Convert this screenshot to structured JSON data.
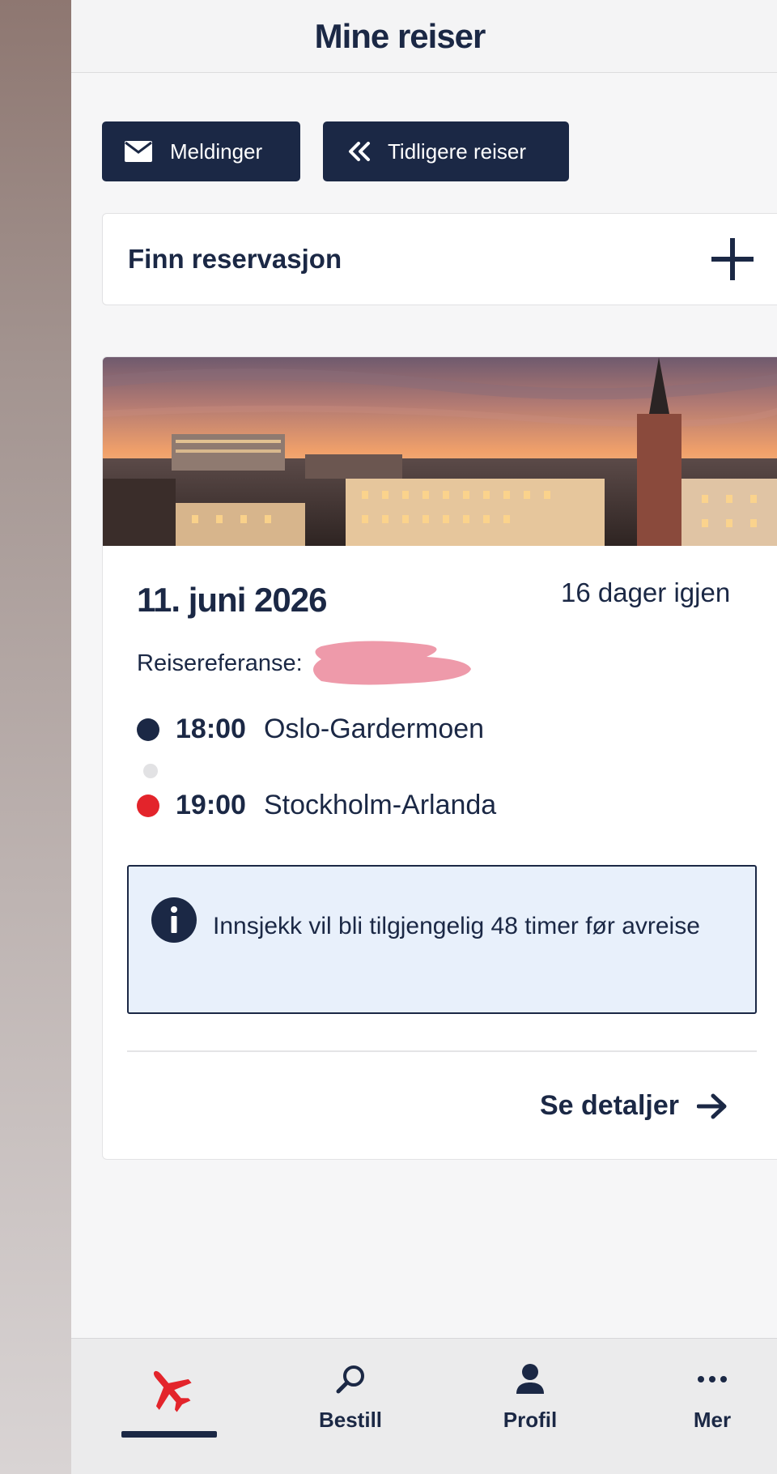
{
  "header": {
    "title": "Mine reiser"
  },
  "actions": {
    "messages_label": "Meldinger",
    "past_trips_label": "Tidligere reiser"
  },
  "find": {
    "label": "Finn reservasjon"
  },
  "trip": {
    "date": "11. juni 2026",
    "days_left": "16 dager igjen",
    "reference_label": "Reisereferanse:",
    "departure": {
      "time": "18:00",
      "airport": "Oslo-Gardermoen"
    },
    "arrival": {
      "time": "19:00",
      "airport": "Stockholm-Arlanda"
    },
    "info_text": "Innsjekk vil bli tilgjengelig 48 timer før avreise",
    "details_label": "Se detaljer"
  },
  "nav": {
    "items": [
      {
        "label": "",
        "icon": "plane-icon"
      },
      {
        "label": "Bestill",
        "icon": "search-icon"
      },
      {
        "label": "Profil",
        "icon": "person-icon"
      },
      {
        "label": "Mer",
        "icon": "more-icon"
      }
    ]
  },
  "colors": {
    "navy": "#1b2845",
    "accent_red": "#e3242b",
    "info_bg": "#e8f0fb"
  }
}
